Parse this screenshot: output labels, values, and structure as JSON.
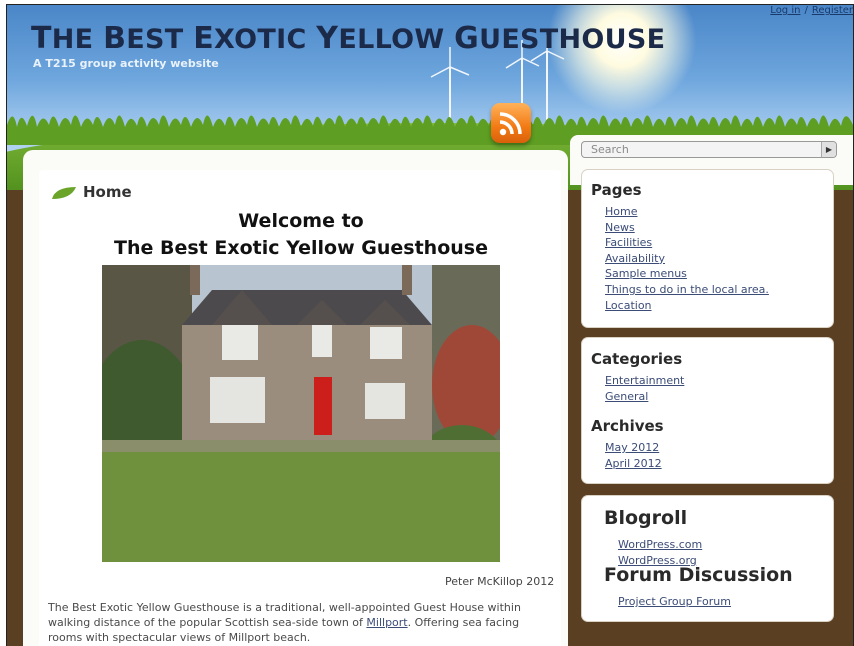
{
  "header": {
    "title_parts": [
      "T",
      "HE ",
      "B",
      "EST ",
      "E",
      "XOTIC ",
      "Y",
      "ELLOW ",
      "G",
      "UESTHOUSE"
    ],
    "subtitle": "A T215 group activity website",
    "login": "Log in",
    "separator": "/",
    "register": "Register",
    "rss_icon": "rss-feed-icon"
  },
  "search": {
    "placeholder": "Search",
    "button_icon": "play-arrow-icon"
  },
  "main": {
    "page_title": "Home",
    "welcome_line1": "Welcome to",
    "welcome_line2": "The Best Exotic Yellow Guesthouse",
    "photo_credit": "Peter McKillop 2012",
    "body_before_link": "The Best Exotic Yellow Guesthouse is a traditional, well-appointed Guest House within walking distance of the popular Scottish sea-side town of ",
    "body_link": "Millport",
    "body_after_link": ". Offering sea facing rooms with spectacular views of Millport beach."
  },
  "sidebar": {
    "pages_title": "Pages",
    "pages": [
      "Home",
      "News",
      "Facilities",
      "Availability",
      "Sample menus",
      "Things to do in the local area.",
      "Location"
    ],
    "categories_title": "Categories",
    "categories": [
      "Entertainment",
      "General"
    ],
    "archives_title": "Archives",
    "archives": [
      "May 2012",
      "April 2012"
    ],
    "blogroll_title": "Blogroll",
    "blogroll": [
      "WordPress.com",
      "WordPress.org"
    ],
    "forum_title": "Forum Discussion",
    "forum": [
      "Project Group Forum"
    ]
  },
  "colors": {
    "accent_link": "#3b4c77",
    "title": "#1c2a4a",
    "rss": "#f27a14",
    "earth": "#5b3f22"
  }
}
